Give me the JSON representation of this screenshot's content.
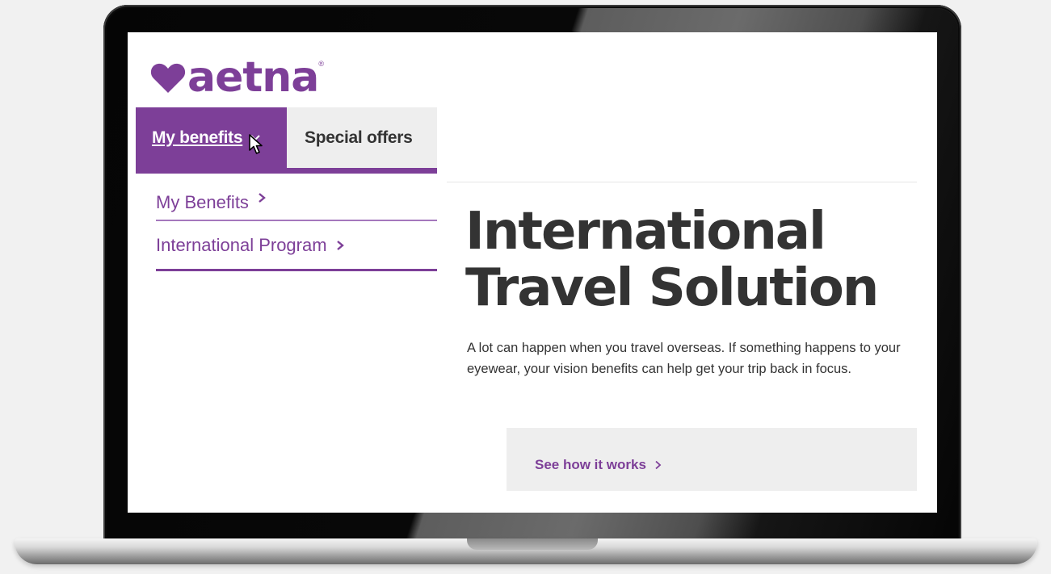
{
  "brand": {
    "name": "aetna",
    "registered_mark": "®",
    "color": "#7d3f98"
  },
  "nav": {
    "tabs": [
      {
        "label": "My benefits",
        "active": true,
        "icon": "chevron-down-icon"
      },
      {
        "label": "Special offers",
        "active": false
      }
    ],
    "dropdown": [
      {
        "label": "My Benefits",
        "icon": "chevron-right-icon"
      },
      {
        "label": "International Program",
        "icon": "chevron-right-icon"
      }
    ]
  },
  "hero": {
    "title_line1": "International",
    "title_line2": "Travel Solution",
    "description": "A lot can happen when you travel overseas. If something happens to your eyewear, your vision benefits can help get your trip back in focus."
  },
  "cta": {
    "label": "See how it works",
    "icon": "chevron-right-icon"
  },
  "colors": {
    "accent": "#7d3f98",
    "text": "#333333",
    "panel": "#eeeeee",
    "background": "#f1f1f1"
  }
}
